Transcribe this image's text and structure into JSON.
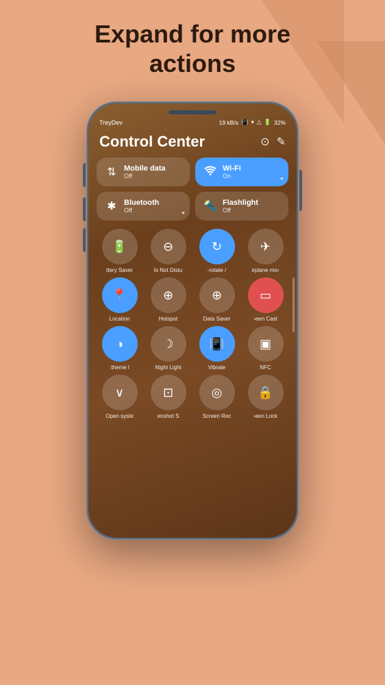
{
  "page": {
    "headline_line1": "Expand for more",
    "headline_line2": "actions"
  },
  "status_bar": {
    "carrier": "TreyDev",
    "speed": "19 kB/s",
    "battery": "32%"
  },
  "control_center": {
    "title": "Control Center"
  },
  "tiles": [
    {
      "id": "mobile-data",
      "name": "Mobile data",
      "status": "Off",
      "icon": "⇅",
      "active": false
    },
    {
      "id": "wifi",
      "name": "Wi-Fi",
      "status": "On",
      "icon": "▾",
      "active": true
    },
    {
      "id": "bluetooth",
      "name": "Bluetooth",
      "status": "Off",
      "icon": "✱",
      "active": false
    },
    {
      "id": "flashlight",
      "name": "Flashlight",
      "status": "Off",
      "icon": "⬛",
      "active": false
    }
  ],
  "circles_row1": [
    {
      "id": "battery-saver",
      "label": "ttery Saver",
      "icon": "🔋",
      "active": false
    },
    {
      "id": "dnd",
      "label": "lo Not Distu",
      "icon": "⊖",
      "active": false
    },
    {
      "id": "rotate",
      "label": "-rotate /",
      "icon": "↻",
      "active": true
    },
    {
      "id": "airplane",
      "label": "irplane mo‹",
      "icon": "✈",
      "active": false
    }
  ],
  "circles_row2": [
    {
      "id": "location",
      "label": "Location",
      "icon": "◎",
      "active": true
    },
    {
      "id": "hotspot",
      "label": "Hotspot",
      "icon": "⊕",
      "active": false
    },
    {
      "id": "data-saver",
      "label": "Data Saver",
      "icon": "⊕",
      "active": false
    },
    {
      "id": "screen-cast",
      "label": "›een Cast",
      "icon": "▭",
      "active": true
    }
  ],
  "circles_row3": [
    {
      "id": "theme",
      "label": ":theme l",
      "icon": "◑",
      "active": true
    },
    {
      "id": "night-light",
      "label": "Night Light",
      "icon": "☽",
      "active": false
    },
    {
      "id": "vibrate",
      "label": "Vibrate",
      "icon": "📳",
      "active": true
    },
    {
      "id": "nfc",
      "label": "NFC",
      "icon": "▣",
      "active": false
    }
  ],
  "circles_row4": [
    {
      "id": "open-syste",
      "label": "Open syste",
      "icon": "∨",
      "active": false
    },
    {
      "id": "screenshot",
      "label": "enshot S",
      "icon": "⊡",
      "active": false
    },
    {
      "id": "screen-rec",
      "label": "Screen Rec",
      "icon": "◎",
      "active": false
    },
    {
      "id": "screen-lock",
      "label": "›een Lock",
      "icon": "🔒",
      "active": false
    }
  ]
}
